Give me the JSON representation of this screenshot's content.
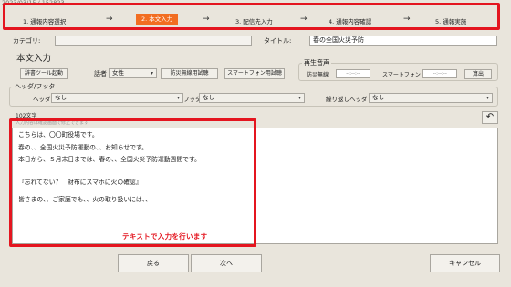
{
  "top_id": "2023/03/15 / 152823",
  "steps": [
    {
      "label": "1. 通報内容選択"
    },
    {
      "label": "2. 本文入力",
      "active": true
    },
    {
      "label": "3. 配信先入力"
    },
    {
      "label": "4. 通報内容確認"
    },
    {
      "label": "5. 通報実施"
    }
  ],
  "arrow": "→",
  "category": {
    "label": "カテゴリ:",
    "value": ""
  },
  "title_field": {
    "label": "タイトル:",
    "value": "春の全国火災予防"
  },
  "section_title": "本文入力",
  "toolbar": {
    "dict_button": "辞書ツール起動",
    "speaker_label": "話者",
    "speaker_value": "女性",
    "disaster_test_button": "防災無線用試聴",
    "smartphone_test_button": "スマートフォン用試聴"
  },
  "playback": {
    "title": "再生音声",
    "disaster_label": "防災無線",
    "disaster_time": "--:--:--",
    "smartphone_label": "スマートフォン",
    "smartphone_time": "--:--:--",
    "calc_button": "算出"
  },
  "header_footer": {
    "title": "ヘッダ/フッタ",
    "header_label": "ヘッダ",
    "header_value": "なし",
    "footer_label": "フッタ",
    "footer_value": "なし",
    "repeat_label": "繰り返しヘッダ",
    "repeat_value": "なし"
  },
  "char_count": "102文字",
  "hint": "入力内容は確認画面で修正できます",
  "body_lines": [
    "こちらは、〇〇町役場です。",
    "",
    "春の、、全国火災予防運動の、、お知らせです。",
    "本日から、５月末日までは、春の、、全国火災予防運動週間です。",
    "",
    "『忘れてない？　財布にスマホに火の確認』",
    "",
    "皆さまの、、ご家庭でも、、火の取り扱いには、、"
  ],
  "note": "テキストで入力を行います",
  "footer_buttons": {
    "back": "戻る",
    "next": "次へ",
    "cancel": "キャンセル"
  },
  "colors": {
    "accent": "#f26d21",
    "highlight": "#e4151f",
    "background": "#e9e5dc"
  }
}
